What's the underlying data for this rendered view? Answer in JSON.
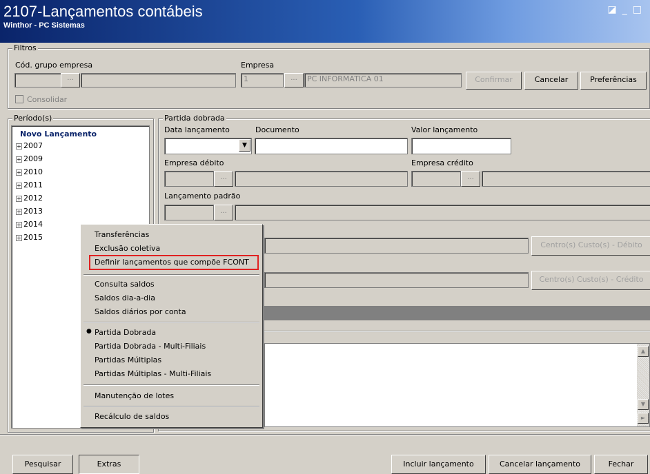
{
  "window": {
    "title": "2107-Lançamentos contábeis",
    "subtitle": "Winthor - PC Sistemas"
  },
  "filtros": {
    "legend": "Filtros",
    "cod_grupo_label": "Cód. grupo empresa",
    "empresa_label": "Empresa",
    "empresa_code": "1",
    "empresa_name": "PC INFORMATICA 01",
    "consolidar": "Consolidar",
    "confirmar": "Confirmar",
    "cancelar": "Cancelar",
    "preferencias": "Preferências"
  },
  "periodos": {
    "legend": "Período(s)",
    "novo": "Novo Lançamento",
    "years": [
      "2007",
      "2009",
      "2010",
      "2011",
      "2012",
      "2013",
      "2014",
      "2015"
    ]
  },
  "partida": {
    "legend": "Partida dobrada",
    "data_label": "Data lançamento",
    "documento_label": "Documento",
    "valor_label": "Valor lançamento",
    "empresa_debito": "Empresa débito",
    "empresa_credito": "Empresa crédito",
    "lancamento_padrao": "Lançamento padrão",
    "cc_debito": "Centro(s) Custo(s) - Débito",
    "cc_credito": "Centro(s) Custo(s) - Crédito"
  },
  "menu": {
    "items": [
      "Transferências",
      "Exclusão coletiva",
      "Definir lançamentos que compõe FCONT",
      "Consulta saldos",
      "Saldos dia-a-dia",
      "Saldos diários por conta",
      "Partida Dobrada",
      "Partida Dobrada - Multi-Filiais",
      "Partidas Múltiplas",
      "Partidas Múltiplas - Multi-Filiais",
      "Manutenção de lotes",
      "Recálculo de saldos"
    ],
    "bullet": "●"
  },
  "bottom": {
    "pesquisar": "Pesquisar",
    "extras": "Extras",
    "incluir": "Incluir lançamento",
    "cancelar": "Cancelar lançamento",
    "fechar": "Fechar"
  },
  "icons": {
    "dots": "...",
    "dropdown": "▼",
    "plus": "+",
    "up": "▲",
    "down": "▼",
    "right": "►"
  },
  "colors": {
    "highlight_border": "#e02020",
    "title_blue": "#0a246a",
    "bg": "#d4d0c8"
  }
}
